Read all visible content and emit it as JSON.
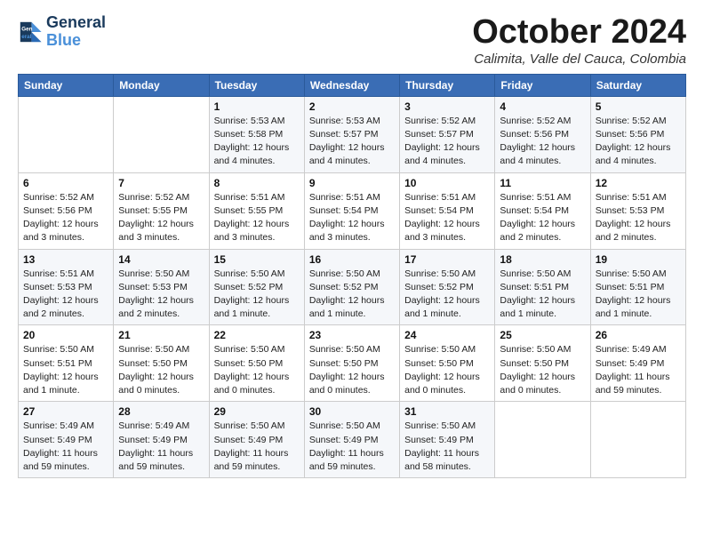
{
  "logo": {
    "line1": "General",
    "line2": "Blue"
  },
  "header": {
    "month": "October 2024",
    "location": "Calimita, Valle del Cauca, Colombia"
  },
  "weekdays": [
    "Sunday",
    "Monday",
    "Tuesday",
    "Wednesday",
    "Thursday",
    "Friday",
    "Saturday"
  ],
  "weeks": [
    [
      {
        "day": "",
        "info": ""
      },
      {
        "day": "",
        "info": ""
      },
      {
        "day": "1",
        "info": "Sunrise: 5:53 AM\nSunset: 5:58 PM\nDaylight: 12 hours and 4 minutes."
      },
      {
        "day": "2",
        "info": "Sunrise: 5:53 AM\nSunset: 5:57 PM\nDaylight: 12 hours and 4 minutes."
      },
      {
        "day": "3",
        "info": "Sunrise: 5:52 AM\nSunset: 5:57 PM\nDaylight: 12 hours and 4 minutes."
      },
      {
        "day": "4",
        "info": "Sunrise: 5:52 AM\nSunset: 5:56 PM\nDaylight: 12 hours and 4 minutes."
      },
      {
        "day": "5",
        "info": "Sunrise: 5:52 AM\nSunset: 5:56 PM\nDaylight: 12 hours and 4 minutes."
      }
    ],
    [
      {
        "day": "6",
        "info": "Sunrise: 5:52 AM\nSunset: 5:56 PM\nDaylight: 12 hours and 3 minutes."
      },
      {
        "day": "7",
        "info": "Sunrise: 5:52 AM\nSunset: 5:55 PM\nDaylight: 12 hours and 3 minutes."
      },
      {
        "day": "8",
        "info": "Sunrise: 5:51 AM\nSunset: 5:55 PM\nDaylight: 12 hours and 3 minutes."
      },
      {
        "day": "9",
        "info": "Sunrise: 5:51 AM\nSunset: 5:54 PM\nDaylight: 12 hours and 3 minutes."
      },
      {
        "day": "10",
        "info": "Sunrise: 5:51 AM\nSunset: 5:54 PM\nDaylight: 12 hours and 3 minutes."
      },
      {
        "day": "11",
        "info": "Sunrise: 5:51 AM\nSunset: 5:54 PM\nDaylight: 12 hours and 2 minutes."
      },
      {
        "day": "12",
        "info": "Sunrise: 5:51 AM\nSunset: 5:53 PM\nDaylight: 12 hours and 2 minutes."
      }
    ],
    [
      {
        "day": "13",
        "info": "Sunrise: 5:51 AM\nSunset: 5:53 PM\nDaylight: 12 hours and 2 minutes."
      },
      {
        "day": "14",
        "info": "Sunrise: 5:50 AM\nSunset: 5:53 PM\nDaylight: 12 hours and 2 minutes."
      },
      {
        "day": "15",
        "info": "Sunrise: 5:50 AM\nSunset: 5:52 PM\nDaylight: 12 hours and 1 minute."
      },
      {
        "day": "16",
        "info": "Sunrise: 5:50 AM\nSunset: 5:52 PM\nDaylight: 12 hours and 1 minute."
      },
      {
        "day": "17",
        "info": "Sunrise: 5:50 AM\nSunset: 5:52 PM\nDaylight: 12 hours and 1 minute."
      },
      {
        "day": "18",
        "info": "Sunrise: 5:50 AM\nSunset: 5:51 PM\nDaylight: 12 hours and 1 minute."
      },
      {
        "day": "19",
        "info": "Sunrise: 5:50 AM\nSunset: 5:51 PM\nDaylight: 12 hours and 1 minute."
      }
    ],
    [
      {
        "day": "20",
        "info": "Sunrise: 5:50 AM\nSunset: 5:51 PM\nDaylight: 12 hours and 1 minute."
      },
      {
        "day": "21",
        "info": "Sunrise: 5:50 AM\nSunset: 5:50 PM\nDaylight: 12 hours and 0 minutes."
      },
      {
        "day": "22",
        "info": "Sunrise: 5:50 AM\nSunset: 5:50 PM\nDaylight: 12 hours and 0 minutes."
      },
      {
        "day": "23",
        "info": "Sunrise: 5:50 AM\nSunset: 5:50 PM\nDaylight: 12 hours and 0 minutes."
      },
      {
        "day": "24",
        "info": "Sunrise: 5:50 AM\nSunset: 5:50 PM\nDaylight: 12 hours and 0 minutes."
      },
      {
        "day": "25",
        "info": "Sunrise: 5:50 AM\nSunset: 5:50 PM\nDaylight: 12 hours and 0 minutes."
      },
      {
        "day": "26",
        "info": "Sunrise: 5:49 AM\nSunset: 5:49 PM\nDaylight: 11 hours and 59 minutes."
      }
    ],
    [
      {
        "day": "27",
        "info": "Sunrise: 5:49 AM\nSunset: 5:49 PM\nDaylight: 11 hours and 59 minutes."
      },
      {
        "day": "28",
        "info": "Sunrise: 5:49 AM\nSunset: 5:49 PM\nDaylight: 11 hours and 59 minutes."
      },
      {
        "day": "29",
        "info": "Sunrise: 5:50 AM\nSunset: 5:49 PM\nDaylight: 11 hours and 59 minutes."
      },
      {
        "day": "30",
        "info": "Sunrise: 5:50 AM\nSunset: 5:49 PM\nDaylight: 11 hours and 59 minutes."
      },
      {
        "day": "31",
        "info": "Sunrise: 5:50 AM\nSunset: 5:49 PM\nDaylight: 11 hours and 58 minutes."
      },
      {
        "day": "",
        "info": ""
      },
      {
        "day": "",
        "info": ""
      }
    ]
  ]
}
